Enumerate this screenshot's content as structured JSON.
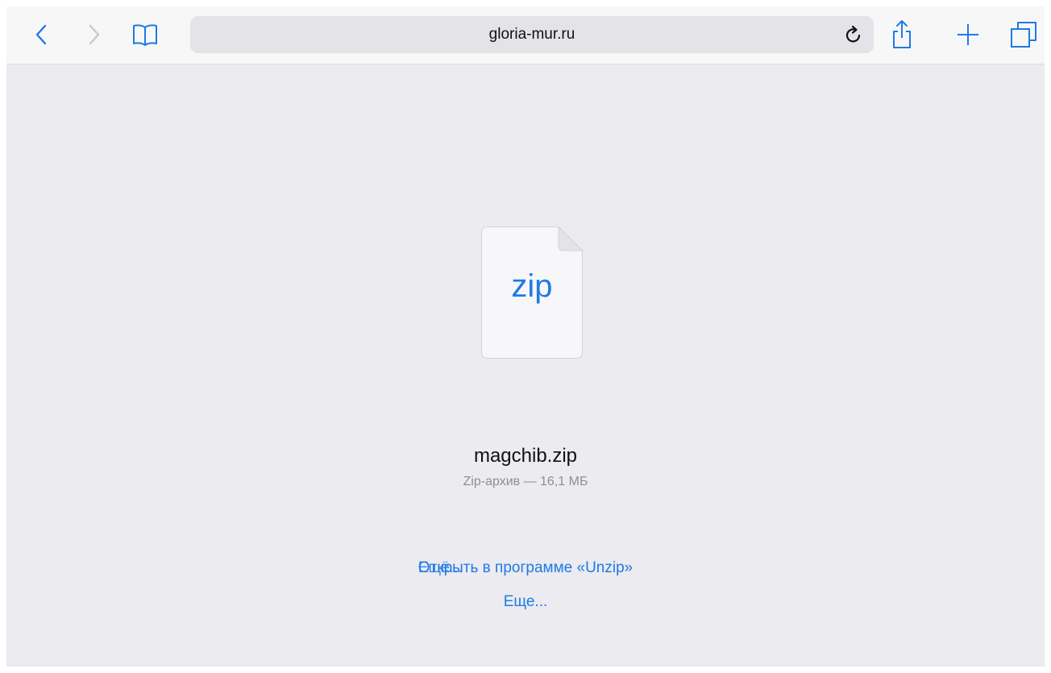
{
  "browser": {
    "address": "gloria-mur.ru",
    "icons": {
      "back": "chevron-left-icon",
      "forward": "chevron-right-icon",
      "bookmarks": "book-icon",
      "reload": "reload-icon",
      "share": "share-icon",
      "new_tab": "plus-icon",
      "tabs": "tabs-icon"
    }
  },
  "download": {
    "file_icon_label": "zip",
    "file_name": "magchib.zip",
    "file_meta": "Zip-архив — 16,1 МБ",
    "open_in_label": "Открыть в программе «Unzip»",
    "open_in_overlay_label": "Ещё...",
    "more_label": "Еще..."
  },
  "colors": {
    "accent": "#1f7ae6",
    "page_background": "#ebebf0",
    "toolbar_background": "#f7f7f7",
    "address_bar_background": "#e3e3e8",
    "secondary_text": "#8e8e93"
  }
}
